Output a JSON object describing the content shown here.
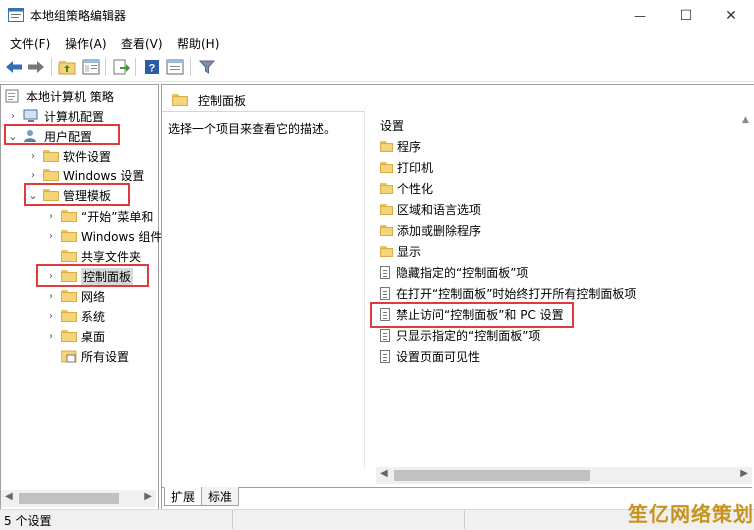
{
  "window": {
    "title": "本地组策略编辑器",
    "minimize_glyph": "—",
    "maximize_glyph": "☐",
    "close_glyph": "✕"
  },
  "menu": [
    {
      "label": "文件(F)"
    },
    {
      "label": "操作(A)"
    },
    {
      "label": "查看(V)"
    },
    {
      "label": "帮助(H)"
    }
  ],
  "toolbar": {
    "icons": [
      "back-icon",
      "forward-icon",
      "up-folder-icon",
      "show-hide-tree-icon",
      "export-list-icon",
      "help-icon",
      "properties-pane-icon",
      "filter-icon"
    ]
  },
  "tree": {
    "root": "本地计算机 策略",
    "computer_config": "计算机配置",
    "user_config": "用户配置",
    "software_settings": "软件设置",
    "windows_settings": "Windows 设置",
    "admin_templates": "管理模板",
    "start_menu": "“开始”菜单和",
    "windows_components": "Windows 组件",
    "shared_folders": "共享文件夹",
    "control_panel": "控制面板",
    "network": "网络",
    "system": "系统",
    "desktop": "桌面",
    "all_settings": "所有设置"
  },
  "right_pane": {
    "header": "控制面板",
    "description": "选择一个项目来查看它的描述。",
    "column_header": "设置",
    "folders": [
      "程序",
      "打印机",
      "个性化",
      "区域和语言选项",
      "添加或删除程序",
      "显示"
    ],
    "settings": [
      "隐藏指定的“控制面板”项",
      "在打开“控制面板”时始终打开所有控制面板项",
      "禁止访问“控制面板”和 PC 设置",
      "只显示指定的“控制面板”项",
      "设置页面可见性"
    ]
  },
  "tabs": {
    "extended": "扩展",
    "standard": "标准"
  },
  "status": {
    "text": "5 个设置"
  },
  "watermark": {
    "text": "笙亿网络策划"
  },
  "colors": {
    "highlight_red": "#e0393e",
    "folder_yellow": "#f4d379",
    "watermark_gold": "#c8931a"
  }
}
